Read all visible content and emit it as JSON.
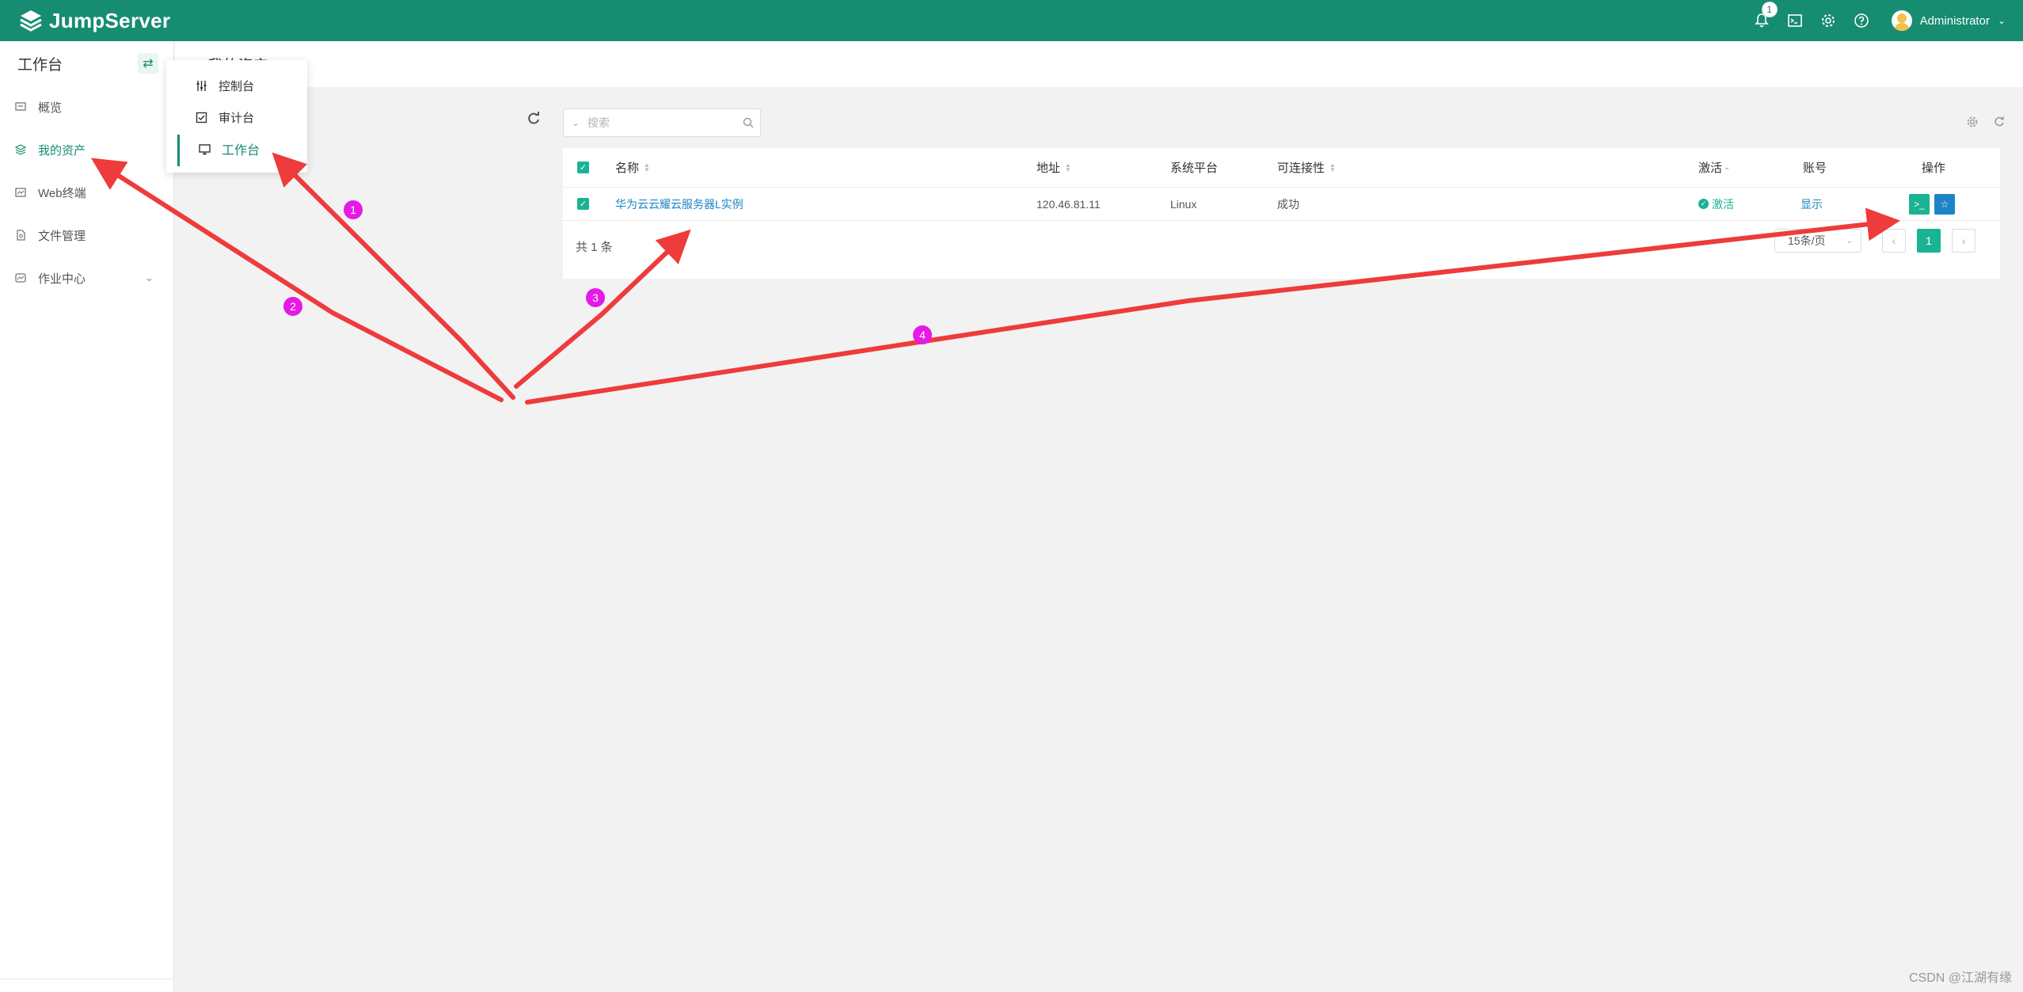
{
  "topbar": {
    "brand": "JumpServer",
    "notification_count": "1",
    "user_name": "Administrator",
    "icons": [
      "bell-icon",
      "terminal-icon",
      "gear-icon",
      "help-icon"
    ],
    "color": "#168c70"
  },
  "sidebar": {
    "title": "工作台",
    "switch_icon": "swap-icon",
    "items": [
      {
        "label": "概览",
        "icon": "dashboard-icon",
        "active": false
      },
      {
        "label": "我的资产",
        "icon": "layers-icon",
        "active": true
      },
      {
        "label": "Web终端",
        "icon": "terminal-icon",
        "active": false
      },
      {
        "label": "文件管理",
        "icon": "file-icon",
        "active": false
      },
      {
        "label": "作业中心",
        "icon": "job-icon",
        "active": false,
        "expandable": true
      }
    ]
  },
  "breadcrumb": {
    "partial": "· 我的资产"
  },
  "view_dropdown": {
    "items": [
      {
        "label": "控制台",
        "icon": "sliders-icon"
      },
      {
        "label": "审计台",
        "icon": "checkbox-icon"
      },
      {
        "label": "工作台",
        "icon": "monitor-icon",
        "active": true
      }
    ]
  },
  "search": {
    "placeholder": "搜索"
  },
  "table": {
    "headers": {
      "name": "名称",
      "address": "地址",
      "platform": "系统平台",
      "connectivity": "可连接性",
      "active": "激活",
      "account": "账号",
      "actions": "操作"
    },
    "rows": [
      {
        "name": "华为云云耀云服务器L实例",
        "address": "120.46.81.11",
        "platform": "Linux",
        "connectivity": "成功",
        "active": "激活",
        "account": "显示"
      }
    ],
    "total": "共 1 条",
    "page_size": "15条/页",
    "current_page": "1"
  },
  "annotations": {
    "badges": [
      "1",
      "2",
      "3",
      "4"
    ],
    "arrow_color": "#ee3b3b",
    "badge_color": "#e619e6"
  },
  "watermark": "CSDN @江湖有缘"
}
